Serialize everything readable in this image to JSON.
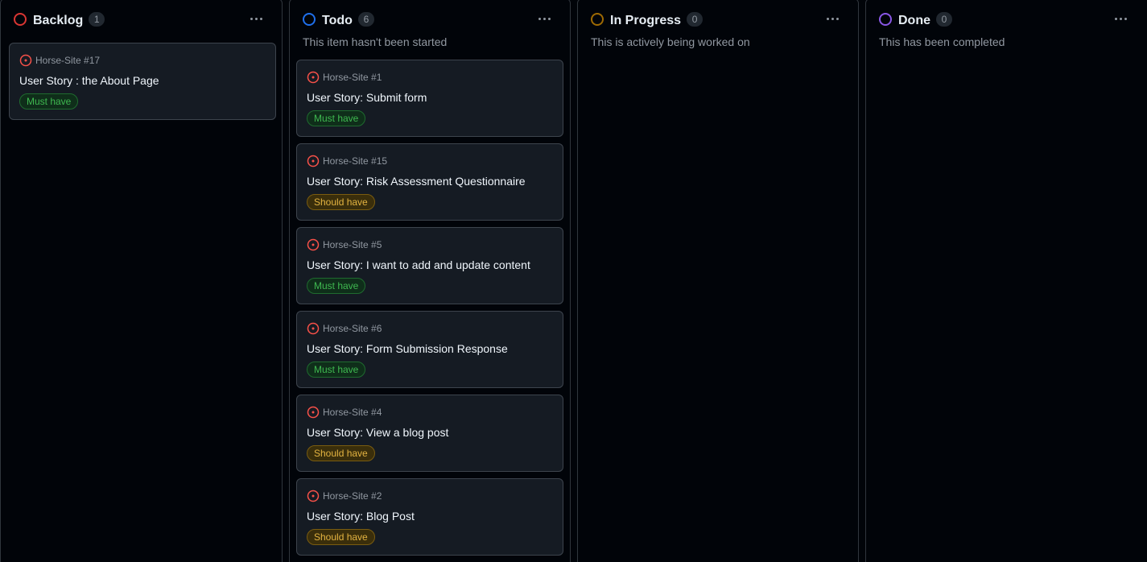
{
  "colors": {
    "backlog": "#da3633",
    "todo": "#1f6feb",
    "in_progress": "#9e6a03",
    "done": "#8957e5",
    "issue_open": "#f85149"
  },
  "columns": [
    {
      "title": "Backlog",
      "count": "1",
      "status_color": "backlog",
      "cards": [
        {
          "ref": "Horse-Site #17",
          "title": "User Story : the About Page",
          "label": "Must have",
          "label_type": "must"
        }
      ]
    },
    {
      "title": "Todo",
      "count": "6",
      "status_color": "todo",
      "description": "This item hasn't been started",
      "cards": [
        {
          "ref": "Horse-Site #1",
          "title": "User Story: Submit form",
          "label": "Must have",
          "label_type": "must"
        },
        {
          "ref": "Horse-Site #15",
          "title": "User Story: Risk Assessment Questionnaire",
          "label": "Should have",
          "label_type": "should"
        },
        {
          "ref": "Horse-Site #5",
          "title": "User Story: I want to add and update content",
          "label": "Must have",
          "label_type": "must"
        },
        {
          "ref": "Horse-Site #6",
          "title": "User Story: Form Submission Response",
          "label": "Must have",
          "label_type": "must"
        },
        {
          "ref": "Horse-Site #4",
          "title": "User Story: View a blog post",
          "label": "Should have",
          "label_type": "should"
        },
        {
          "ref": "Horse-Site #2",
          "title": "User Story: Blog Post",
          "label": "Should have",
          "label_type": "should"
        }
      ]
    },
    {
      "title": "In Progress",
      "count": "0",
      "status_color": "in_progress",
      "description": "This is actively being worked on",
      "cards": []
    },
    {
      "title": "Done",
      "count": "0",
      "status_color": "done",
      "description": "This has been completed",
      "cards": []
    }
  ]
}
